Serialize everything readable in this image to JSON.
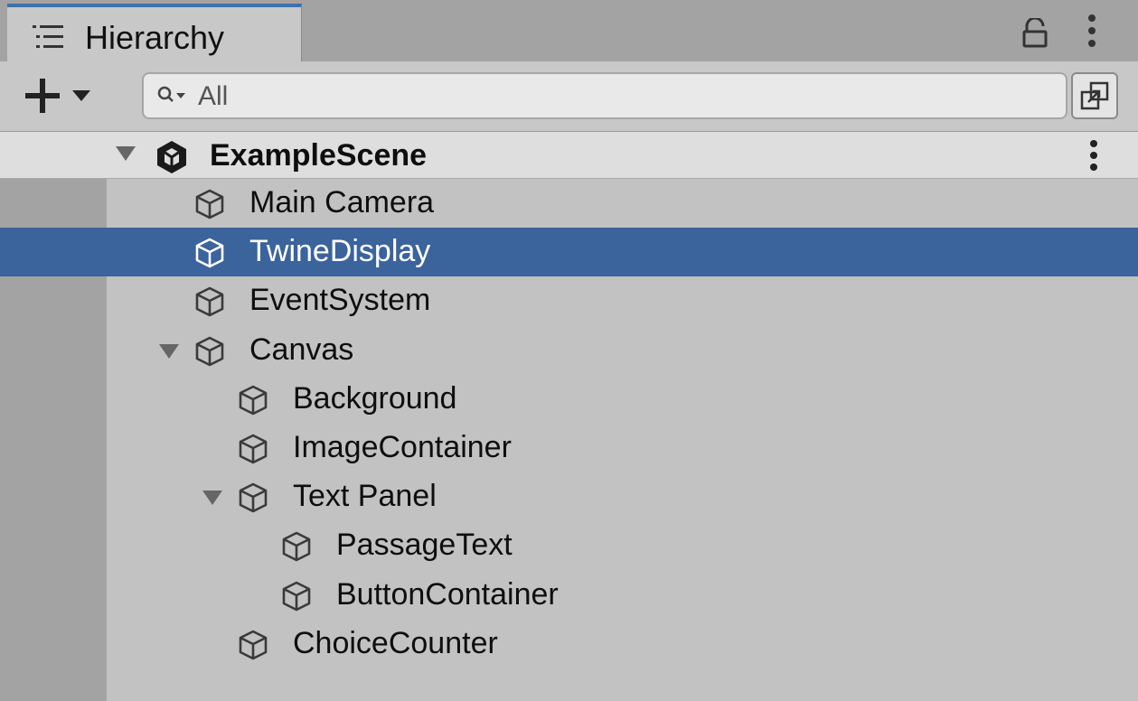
{
  "panel": {
    "title": "Hierarchy",
    "title_icon": "hierarchy-list-icon",
    "lock_icon": "lock-icon",
    "menu_icon": "kebab-menu-icon"
  },
  "toolbar": {
    "add_icon": "plus-dropdown-icon",
    "search_placeholder": "All",
    "search_value": "",
    "scene_visibility_icon": "scene-visibility-icon"
  },
  "scene": {
    "name": "ExampleScene",
    "icon": "unity-logo-icon",
    "expanded": true
  },
  "items": [
    {
      "label": "Main Camera",
      "depth": 0,
      "expandable": false,
      "selected": false
    },
    {
      "label": "TwineDisplay",
      "depth": 0,
      "expandable": false,
      "selected": true
    },
    {
      "label": "EventSystem",
      "depth": 0,
      "expandable": false,
      "selected": false
    },
    {
      "label": "Canvas",
      "depth": 0,
      "expandable": true,
      "expanded": true,
      "selected": false
    },
    {
      "label": "Background",
      "depth": 1,
      "expandable": false,
      "selected": false
    },
    {
      "label": "ImageContainer",
      "depth": 1,
      "expandable": false,
      "selected": false
    },
    {
      "label": "Text Panel",
      "depth": 1,
      "expandable": true,
      "expanded": true,
      "selected": false
    },
    {
      "label": "PassageText",
      "depth": 2,
      "expandable": false,
      "selected": false
    },
    {
      "label": "ButtonContainer",
      "depth": 2,
      "expandable": false,
      "selected": false
    },
    {
      "label": "ChoiceCounter",
      "depth": 1,
      "expandable": false,
      "selected": false
    }
  ],
  "colors": {
    "selection": "#3b639c",
    "tab_accent": "#3a72b0",
    "panel_bg": "#c2c2c2"
  }
}
